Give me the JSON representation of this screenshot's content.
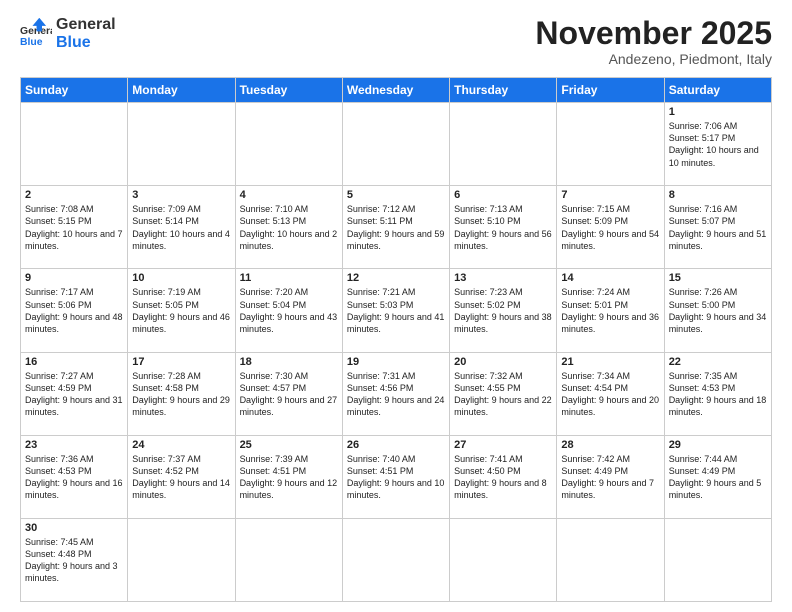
{
  "header": {
    "logo_general": "General",
    "logo_blue": "Blue",
    "month": "November 2025",
    "location": "Andezeno, Piedmont, Italy"
  },
  "days_of_week": [
    "Sunday",
    "Monday",
    "Tuesday",
    "Wednesday",
    "Thursday",
    "Friday",
    "Saturday"
  ],
  "weeks": [
    [
      {
        "day": "",
        "info": ""
      },
      {
        "day": "",
        "info": ""
      },
      {
        "day": "",
        "info": ""
      },
      {
        "day": "",
        "info": ""
      },
      {
        "day": "",
        "info": ""
      },
      {
        "day": "",
        "info": ""
      },
      {
        "day": "1",
        "info": "Sunrise: 7:06 AM\nSunset: 5:17 PM\nDaylight: 10 hours and 10 minutes."
      }
    ],
    [
      {
        "day": "2",
        "info": "Sunrise: 7:08 AM\nSunset: 5:15 PM\nDaylight: 10 hours and 7 minutes."
      },
      {
        "day": "3",
        "info": "Sunrise: 7:09 AM\nSunset: 5:14 PM\nDaylight: 10 hours and 4 minutes."
      },
      {
        "day": "4",
        "info": "Sunrise: 7:10 AM\nSunset: 5:13 PM\nDaylight: 10 hours and 2 minutes."
      },
      {
        "day": "5",
        "info": "Sunrise: 7:12 AM\nSunset: 5:11 PM\nDaylight: 9 hours and 59 minutes."
      },
      {
        "day": "6",
        "info": "Sunrise: 7:13 AM\nSunset: 5:10 PM\nDaylight: 9 hours and 56 minutes."
      },
      {
        "day": "7",
        "info": "Sunrise: 7:15 AM\nSunset: 5:09 PM\nDaylight: 9 hours and 54 minutes."
      },
      {
        "day": "8",
        "info": "Sunrise: 7:16 AM\nSunset: 5:07 PM\nDaylight: 9 hours and 51 minutes."
      }
    ],
    [
      {
        "day": "9",
        "info": "Sunrise: 7:17 AM\nSunset: 5:06 PM\nDaylight: 9 hours and 48 minutes."
      },
      {
        "day": "10",
        "info": "Sunrise: 7:19 AM\nSunset: 5:05 PM\nDaylight: 9 hours and 46 minutes."
      },
      {
        "day": "11",
        "info": "Sunrise: 7:20 AM\nSunset: 5:04 PM\nDaylight: 9 hours and 43 minutes."
      },
      {
        "day": "12",
        "info": "Sunrise: 7:21 AM\nSunset: 5:03 PM\nDaylight: 9 hours and 41 minutes."
      },
      {
        "day": "13",
        "info": "Sunrise: 7:23 AM\nSunset: 5:02 PM\nDaylight: 9 hours and 38 minutes."
      },
      {
        "day": "14",
        "info": "Sunrise: 7:24 AM\nSunset: 5:01 PM\nDaylight: 9 hours and 36 minutes."
      },
      {
        "day": "15",
        "info": "Sunrise: 7:26 AM\nSunset: 5:00 PM\nDaylight: 9 hours and 34 minutes."
      }
    ],
    [
      {
        "day": "16",
        "info": "Sunrise: 7:27 AM\nSunset: 4:59 PM\nDaylight: 9 hours and 31 minutes."
      },
      {
        "day": "17",
        "info": "Sunrise: 7:28 AM\nSunset: 4:58 PM\nDaylight: 9 hours and 29 minutes."
      },
      {
        "day": "18",
        "info": "Sunrise: 7:30 AM\nSunset: 4:57 PM\nDaylight: 9 hours and 27 minutes."
      },
      {
        "day": "19",
        "info": "Sunrise: 7:31 AM\nSunset: 4:56 PM\nDaylight: 9 hours and 24 minutes."
      },
      {
        "day": "20",
        "info": "Sunrise: 7:32 AM\nSunset: 4:55 PM\nDaylight: 9 hours and 22 minutes."
      },
      {
        "day": "21",
        "info": "Sunrise: 7:34 AM\nSunset: 4:54 PM\nDaylight: 9 hours and 20 minutes."
      },
      {
        "day": "22",
        "info": "Sunrise: 7:35 AM\nSunset: 4:53 PM\nDaylight: 9 hours and 18 minutes."
      }
    ],
    [
      {
        "day": "23",
        "info": "Sunrise: 7:36 AM\nSunset: 4:53 PM\nDaylight: 9 hours and 16 minutes."
      },
      {
        "day": "24",
        "info": "Sunrise: 7:37 AM\nSunset: 4:52 PM\nDaylight: 9 hours and 14 minutes."
      },
      {
        "day": "25",
        "info": "Sunrise: 7:39 AM\nSunset: 4:51 PM\nDaylight: 9 hours and 12 minutes."
      },
      {
        "day": "26",
        "info": "Sunrise: 7:40 AM\nSunset: 4:51 PM\nDaylight: 9 hours and 10 minutes."
      },
      {
        "day": "27",
        "info": "Sunrise: 7:41 AM\nSunset: 4:50 PM\nDaylight: 9 hours and 8 minutes."
      },
      {
        "day": "28",
        "info": "Sunrise: 7:42 AM\nSunset: 4:49 PM\nDaylight: 9 hours and 7 minutes."
      },
      {
        "day": "29",
        "info": "Sunrise: 7:44 AM\nSunset: 4:49 PM\nDaylight: 9 hours and 5 minutes."
      }
    ],
    [
      {
        "day": "30",
        "info": "Sunrise: 7:45 AM\nSunset: 4:48 PM\nDaylight: 9 hours and 3 minutes."
      },
      {
        "day": "",
        "info": ""
      },
      {
        "day": "",
        "info": ""
      },
      {
        "day": "",
        "info": ""
      },
      {
        "day": "",
        "info": ""
      },
      {
        "day": "",
        "info": ""
      },
      {
        "day": "",
        "info": ""
      }
    ]
  ]
}
